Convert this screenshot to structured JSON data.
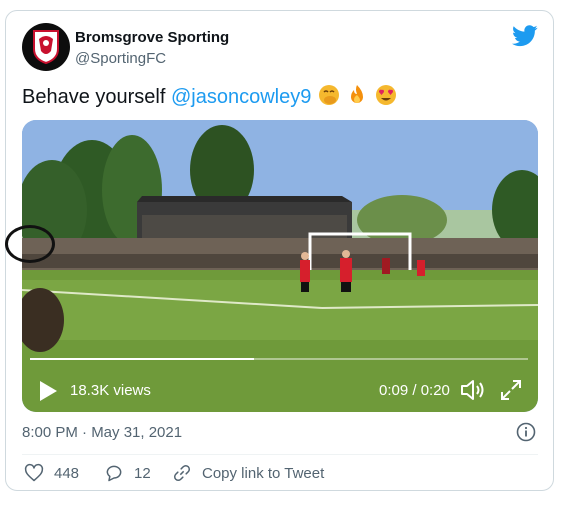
{
  "account": {
    "name": "Bromsgrove Sporting",
    "handle": "@SportingFC"
  },
  "tweet": {
    "text": "Behave yourself",
    "mention": "@jasoncowley9",
    "emojis": [
      "face-with-hand-over-mouth",
      "fire",
      "smiling-face-with-heart-eyes"
    ]
  },
  "video": {
    "views": "18.3K views",
    "time": "0:09 / 0:20",
    "progress_fraction": 0.45
  },
  "timestamp": "8:00 PM · May 31, 2021",
  "actions": {
    "likes": "448",
    "replies": "12",
    "copy_link": "Copy link to Tweet"
  },
  "colors": {
    "accent": "#1d9bf0",
    "secondary_text": "#536471",
    "border": "#cfd9de"
  }
}
